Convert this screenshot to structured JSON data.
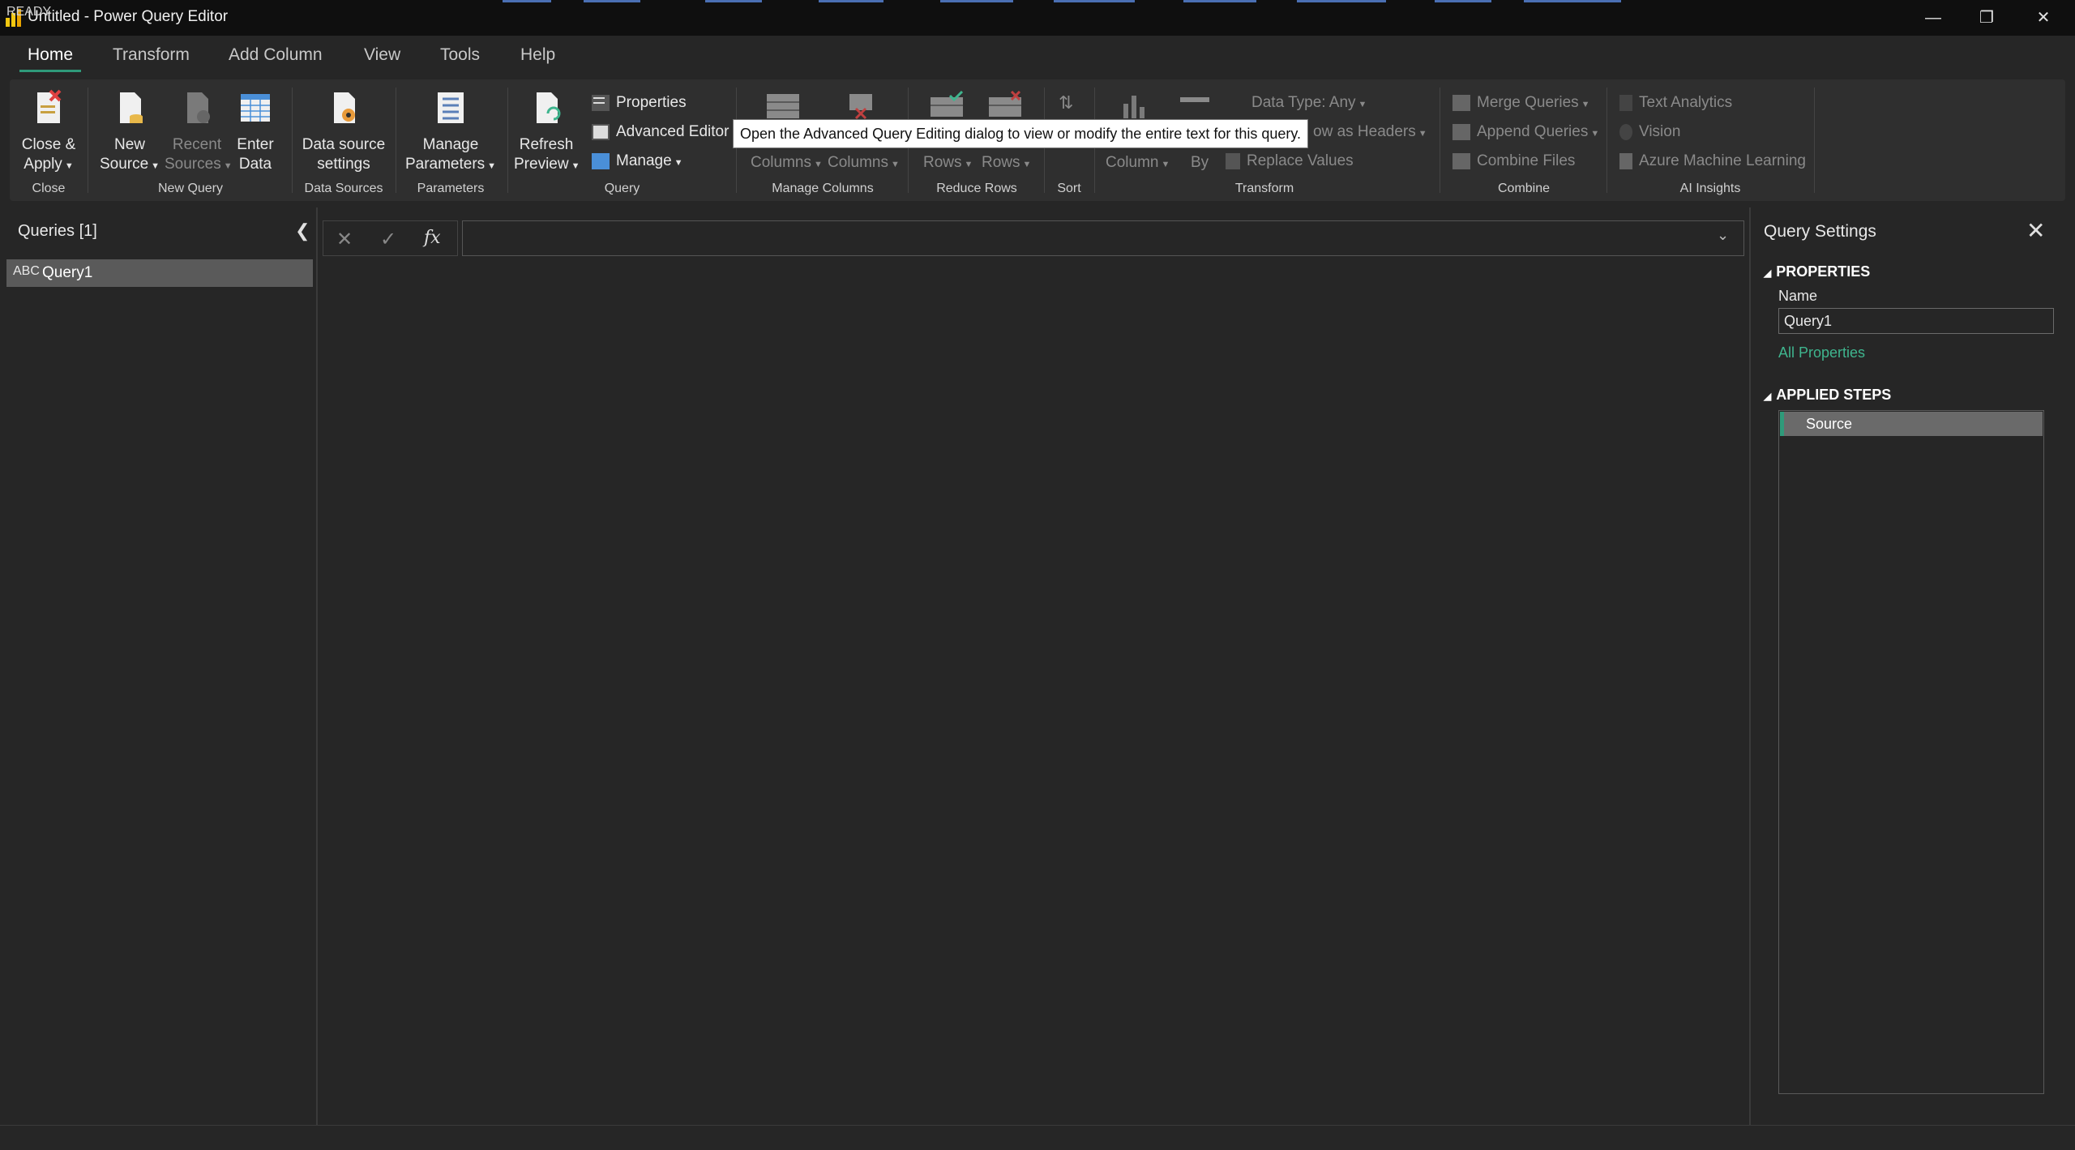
{
  "window": {
    "title": "Untitled - Power Query Editor",
    "controls": {
      "minimize": "—",
      "restore": "❐",
      "close": "✕"
    }
  },
  "menu": {
    "tabs": [
      "Home",
      "Transform",
      "Add Column",
      "View",
      "Tools",
      "Help"
    ],
    "active": "Home"
  },
  "ribbon": {
    "groups": {
      "close": "Close",
      "new_query": "New Query",
      "data_sources": "Data Sources",
      "parameters": "Parameters",
      "query": "Query",
      "manage_columns": "Manage Columns",
      "reduce_rows": "Reduce Rows",
      "sort": "Sort",
      "transform": "Transform",
      "combine": "Combine",
      "ai_insights": "AI Insights"
    },
    "close_apply": {
      "line1": "Close &",
      "line2": "Apply"
    },
    "new_source": {
      "line1": "New",
      "line2": "Source"
    },
    "recent_sources": {
      "line1": "Recent",
      "line2": "Sources"
    },
    "enter_data": {
      "line1": "Enter",
      "line2": "Data"
    },
    "data_source_settings": {
      "line1": "Data source",
      "line2": "settings"
    },
    "manage_parameters": {
      "line1": "Manage",
      "line2": "Parameters"
    },
    "refresh_preview": {
      "line1": "Refresh",
      "line2": "Preview"
    },
    "properties": "Properties",
    "advanced_editor": "Advanced Editor",
    "manage": "Manage",
    "choose_columns": "Columns",
    "remove_columns": "Columns",
    "keep_rows": "Rows",
    "remove_rows": "Rows",
    "split_column": "Column",
    "group_by": "By",
    "data_type": "Data Type: Any",
    "use_first_row": "ow as Headers",
    "replace_values": "Replace Values",
    "merge_queries": "Merge Queries",
    "append_queries": "Append Queries",
    "combine_files": "Combine Files",
    "text_analytics": "Text Analytics",
    "vision": "Vision",
    "azure_ml": "Azure Machine Learning"
  },
  "tooltip": "Open the Advanced Query Editing dialog to view or modify the entire text for this query.",
  "queries_pane": {
    "title": "Queries [1]",
    "items": [
      {
        "icon": "ABC",
        "name": "Query1"
      }
    ]
  },
  "formula_bar": {
    "value": "",
    "fx": "fx"
  },
  "settings_pane": {
    "title": "Query Settings",
    "properties_header": "PROPERTIES",
    "name_label": "Name",
    "name_value": "Query1",
    "all_properties": "All Properties",
    "applied_steps_header": "APPLIED STEPS",
    "steps": [
      "Source"
    ]
  },
  "status": "READY",
  "colors": {
    "accent_green": "#2f9a7a",
    "link_green": "#3fb58e",
    "background": "#262626",
    "ribbon": "#2f2f2f",
    "titlebar": "#0f0f0f"
  }
}
